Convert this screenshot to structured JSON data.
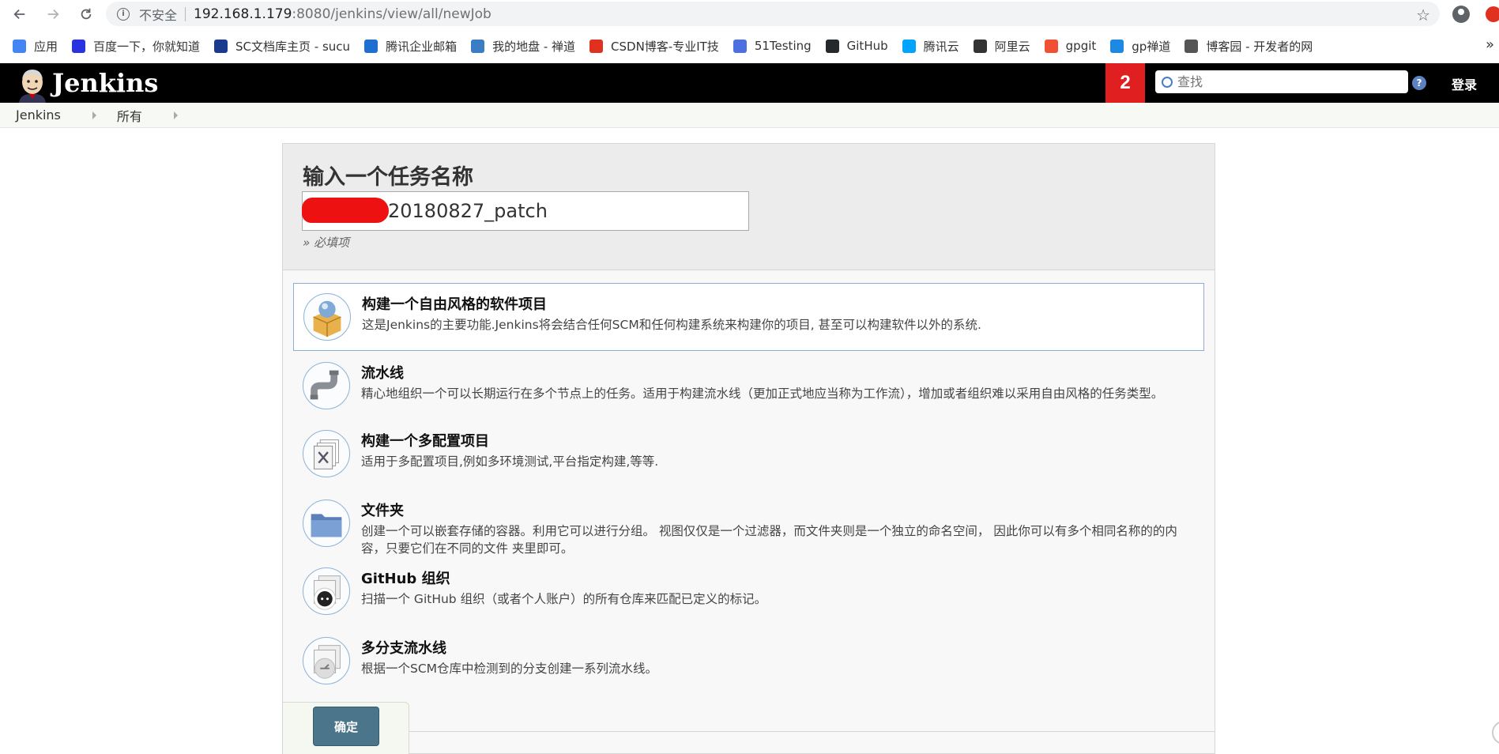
{
  "browser": {
    "insecure_label": "不安全",
    "url_host": "192.168.1.179",
    "url_path": ":8080/jenkins/view/all/newJob"
  },
  "bookmarks": [
    {
      "label": "应用",
      "icon": "apps-grid-icon",
      "color": "#4285f4"
    },
    {
      "label": "百度一下，你就知道",
      "icon": "baidu-paw-icon",
      "color": "#2932e1"
    },
    {
      "label": "SC文档库主页 - sucu",
      "icon": "sc-tools-icon",
      "color": "#1a3a8f"
    },
    {
      "label": "腾讯企业邮箱",
      "icon": "tencent-mail-icon",
      "color": "#1f6fd1"
    },
    {
      "label": "我的地盘 - 禅道",
      "icon": "zentao-globe-icon",
      "color": "#3b7dc4"
    },
    {
      "label": "CSDN博客-专业IT技",
      "icon": "csdn-icon",
      "color": "#e0301e"
    },
    {
      "label": "51Testing",
      "icon": "51testing-icon",
      "color": "#4d6fe0"
    },
    {
      "label": "GitHub",
      "icon": "github-icon",
      "color": "#24292e"
    },
    {
      "label": "腾讯云",
      "icon": "tencent-cloud-icon",
      "color": "#00a4ff"
    },
    {
      "label": "阿里云",
      "icon": "aliyun-icon",
      "color": "#333333"
    },
    {
      "label": "gpgit",
      "icon": "gpgit-icon",
      "color": "#f05033"
    },
    {
      "label": "gp禅道",
      "icon": "gp-zentao-icon",
      "color": "#1e88e5"
    },
    {
      "label": "博客园 - 开发者的网",
      "icon": "cnblogs-icon",
      "color": "#555555"
    }
  ],
  "header": {
    "title": "Jenkins",
    "notification_count": "2",
    "search_placeholder": "查找",
    "help_label": "?",
    "login_label": "登录"
  },
  "breadcrumbs": [
    "Jenkins",
    "所有"
  ],
  "new_item": {
    "title": "输入一个任务名称",
    "name_value": "20180827_patch",
    "required_hint": "» 必填项",
    "items": [
      {
        "label": "构建一个自由风格的软件项目",
        "description": "这是Jenkins的主要功能.Jenkins将会结合任何SCM和任何构建系统来构建你的项目, 甚至可以构建软件以外的系统.",
        "icon": "freestyle-package-icon",
        "selected": true
      },
      {
        "label": "流水线",
        "description": "精心地组织一个可以长期运行在多个节点上的任务。适用于构建流水线（更加正式地应当称为工作流），增加或者组织难以采用自由风格的任务类型。",
        "icon": "pipeline-icon",
        "selected": false
      },
      {
        "label": "构建一个多配置项目",
        "description": "适用于多配置项目,例如多环境测试,平台指定构建,等等.",
        "icon": "multi-config-icon",
        "selected": false
      },
      {
        "label": "文件夹",
        "description": "创建一个可以嵌套存储的容器。利用它可以进行分组。 视图仅仅是一个过滤器，而文件夹则是一个独立的命名空间， 因此你可以有多个相同名称的的内容，只要它们在不同的文件 夹里即可。",
        "icon": "folder-icon",
        "selected": false
      },
      {
        "label": "GitHub 组织",
        "description": "扫描一个 GitHub 组织（或者个人账户）的所有仓库来匹配已定义的标记。",
        "icon": "github-org-icon",
        "selected": false
      },
      {
        "label": "多分支流水线",
        "description": "根据一个SCM仓库中检测到的分支创建一系列流水线。",
        "icon": "multibranch-icon",
        "selected": false
      }
    ],
    "ok_label": "确定"
  }
}
